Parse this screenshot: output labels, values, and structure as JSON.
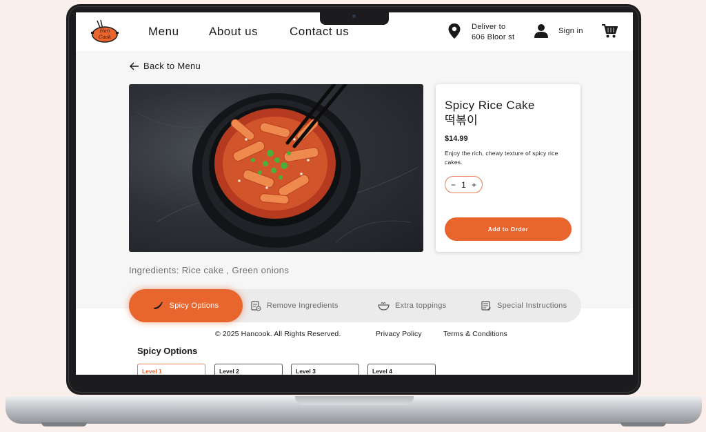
{
  "brand": {
    "logo_text": "Han Cook"
  },
  "nav": {
    "links": [
      "Menu",
      "About us",
      "Contact us"
    ],
    "deliver_label": "Deliver to",
    "deliver_address": "606 Bloor st",
    "signin_label": "Sign in",
    "icons": [
      "location-pin-icon",
      "user-icon",
      "cart-icon"
    ]
  },
  "back_link": "Back to Menu",
  "product": {
    "name": "Spicy Rice Cake",
    "name_korean": "떡볶이",
    "price": "$14.99",
    "description": "Enjoy the rich, chewy texture of spicy rice cakes.",
    "quantity": "1",
    "add_button": "Add to Order"
  },
  "ingredients": "Ingredients: Rice cake , Green onions",
  "tabs": [
    {
      "label": "Spicy Options",
      "icon": "chili-pepper-icon",
      "active": true
    },
    {
      "label": "Remove Ingredients",
      "icon": "clipboard-icon",
      "active": false
    },
    {
      "label": "Extra toppings",
      "icon": "bowl-icon",
      "active": false
    },
    {
      "label": "Special Instructions",
      "icon": "notes-icon",
      "active": false
    }
  ],
  "footer": {
    "copyright": "© 2025 Hancook. All Rights Reserved.",
    "privacy": "Privacy Policy",
    "terms": "Terms & Conditions"
  },
  "spicy_options": {
    "title": "Spicy Options",
    "levels": [
      "Level 1",
      "Level 2",
      "Level 3",
      "Level 4"
    ],
    "selected": "Level 1"
  },
  "colors": {
    "accent": "#e8652e",
    "page_bg": "#f6f6f6",
    "background": "#fbefeb"
  }
}
